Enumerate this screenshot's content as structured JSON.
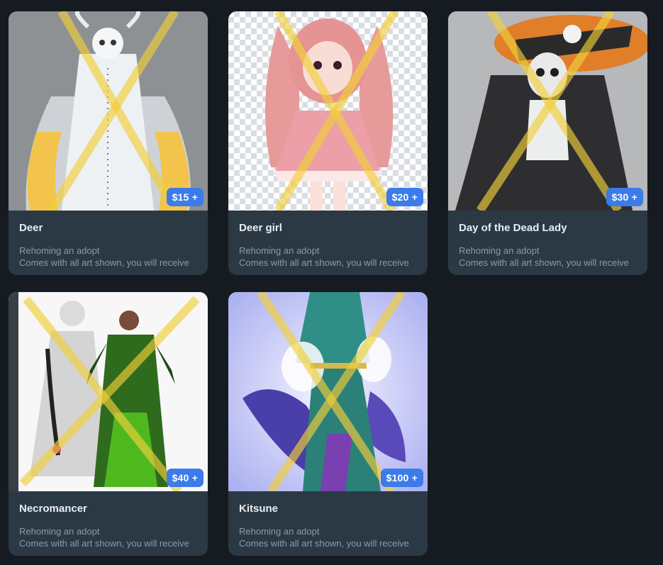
{
  "listings": [
    {
      "title": "Deer",
      "price": "$15 +",
      "subtitle": "Rehoming an adopt",
      "description": "Comes with all art shown, you will receive"
    },
    {
      "title": "Deer girl",
      "price": "$20 +",
      "subtitle": "Rehoming an adopt",
      "description": "Comes with all art shown, you will receive"
    },
    {
      "title": "Day of the Dead Lady",
      "price": "$30 +",
      "subtitle": "Rehoming an adopt",
      "description": "Comes with all art shown, you will receive"
    },
    {
      "title": "Necromancer",
      "price": "$40 +",
      "subtitle": "Rehoming an adopt",
      "description": "Comes with all art shown, you will receive"
    },
    {
      "title": "Kitsune",
      "price": "$100 +",
      "subtitle": "Rehoming an adopt",
      "description": "Comes with all art shown, you will receive"
    }
  ],
  "colors": {
    "page_bg": "#161b22",
    "card_bg": "#2b3945",
    "price_badge": "#3b7bea",
    "watermark_x": "#f2cf3a"
  }
}
